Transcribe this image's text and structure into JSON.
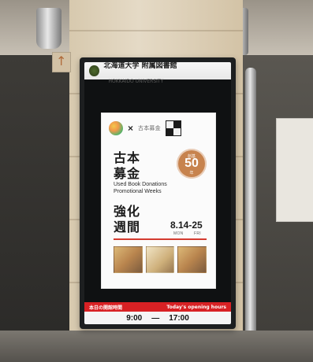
{
  "signage": {
    "header": {
      "university_name_ja": "北海道大学 附属図書館",
      "university_name_en": "HOKKAIDO UNIVERSITY"
    },
    "poster": {
      "title_line_1": "古本",
      "title_line_2": "募金",
      "title_en_line_1": "Used Book Donations",
      "title_en_line_2": "Promotional Weeks",
      "title_line_3": "強化",
      "title_line_4": "週間",
      "dates": "8.14-25",
      "dates_start_label": "MON",
      "dates_end_label": "FRI",
      "badge_top": "創基",
      "badge_number": "50",
      "badge_bottom": "年"
    },
    "hours": {
      "label_ja": "本日の開館時間",
      "label_en": "Today's opening hours",
      "open_time": "9:00",
      "dash": "—",
      "close_time": "17:00"
    }
  },
  "colors": {
    "accent_red": "#d82124",
    "badge_brown": "#c7834e"
  }
}
